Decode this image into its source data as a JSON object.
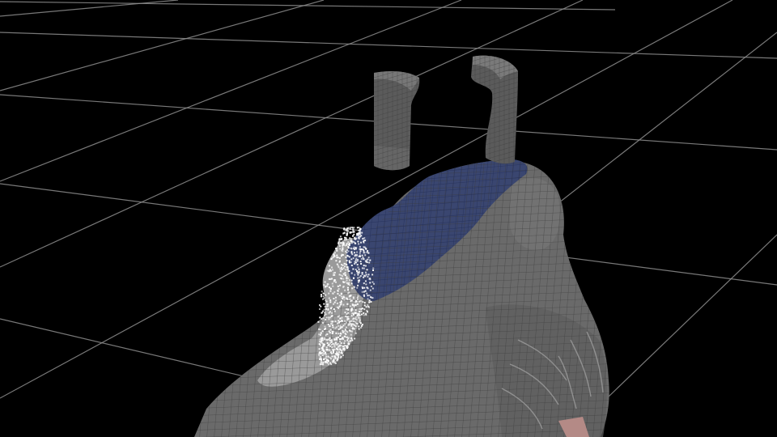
{
  "viewport": {
    "background_color": "#000000",
    "grid_color": "#8e8e8e",
    "shows_grid": true,
    "text_labels": []
  },
  "model": {
    "shoe_body_color": "#6a6a6a",
    "lining_color": "#3a4670",
    "heel_tab_color": "#5b5b5b",
    "highlight_region_color": "#9a9a9a",
    "particle_color": "#ffffff",
    "detached_pieces": 2
  },
  "icons": []
}
